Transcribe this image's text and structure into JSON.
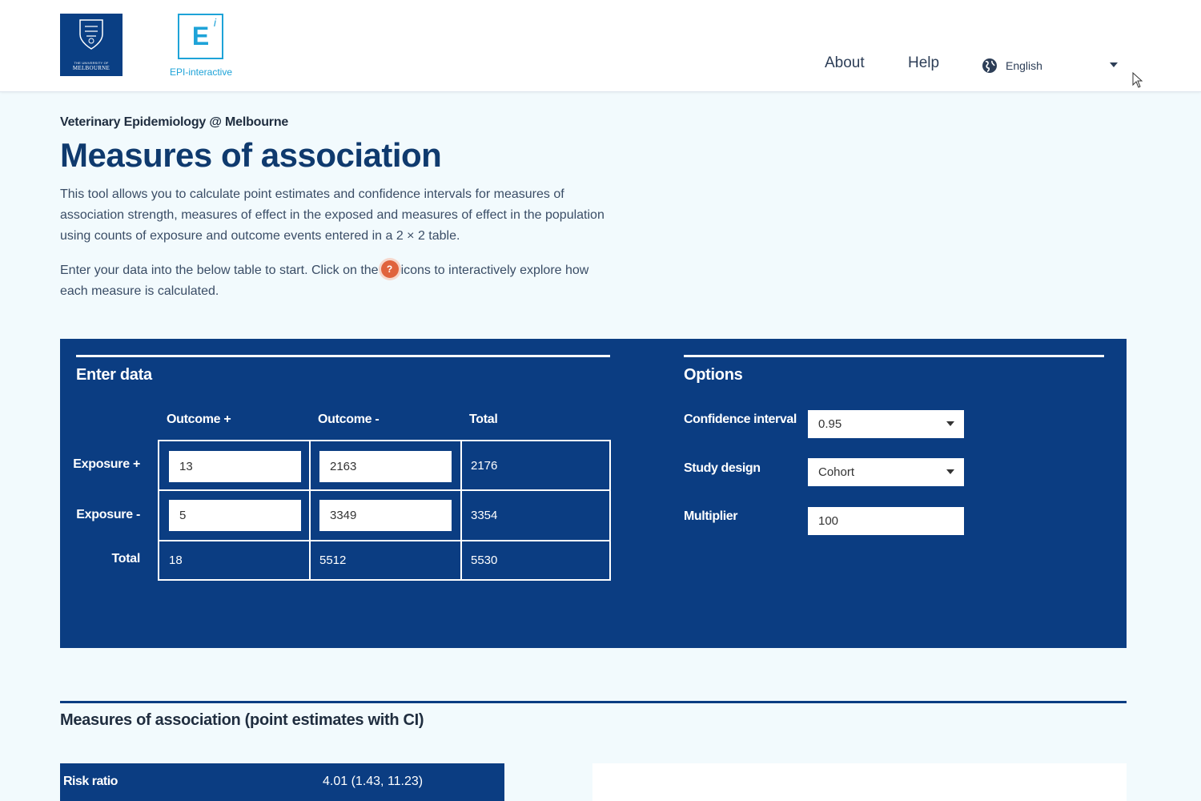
{
  "header": {
    "university_logo": {
      "small_text": "THE UNIVERSITY OF",
      "name": "MELBOURNE"
    },
    "epi_logo": {
      "letter": "E",
      "superscript": "i",
      "label": "EPI-interactive"
    },
    "nav": {
      "about": "About",
      "help": "Help"
    },
    "language": {
      "selected": "English",
      "icon": "globe-icon"
    }
  },
  "page": {
    "breadcrumb": "Veterinary Epidemiology @ Melbourne",
    "title": "Measures of association",
    "intro": "This tool allows you to calculate point estimates and confidence intervals for measures of association strength, measures of effect in the exposed and measures of effect in the population using counts of exposure and outcome events entered in a 2 × 2 table.",
    "instructions_before": "Enter your data into the below table to start. Click on the",
    "help_icon_glyph": "?",
    "instructions_after": "icons to interactively explore how each measure is calculated."
  },
  "enter_data": {
    "heading": "Enter data",
    "columns": [
      "Outcome +",
      "Outcome -",
      "Total"
    ],
    "rows": [
      {
        "label": "Exposure +",
        "outcome_pos": "13",
        "outcome_neg": "2163",
        "total": "2176"
      },
      {
        "label": "Exposure -",
        "outcome_pos": "5",
        "outcome_neg": "3349",
        "total": "3354"
      }
    ],
    "totals": {
      "label": "Total",
      "outcome_pos": "18",
      "outcome_neg": "5512",
      "total": "5530"
    }
  },
  "options": {
    "heading": "Options",
    "confidence_interval": {
      "label": "Confidence interval",
      "value": "0.95"
    },
    "study_design": {
      "label": "Study design",
      "value": "Cohort"
    },
    "multiplier": {
      "label": "Multiplier",
      "value": "100"
    }
  },
  "results": {
    "section_title": "Measures of association (point estimates with CI)",
    "rows": [
      {
        "label": "Risk ratio",
        "value": "4.01 (1.43, 11.23)"
      }
    ]
  },
  "colors": {
    "primary_navy": "#0b3d82",
    "accent_cyan": "#1ea3d8",
    "help_orange": "#e0633d",
    "background": "#f2fafd"
  }
}
